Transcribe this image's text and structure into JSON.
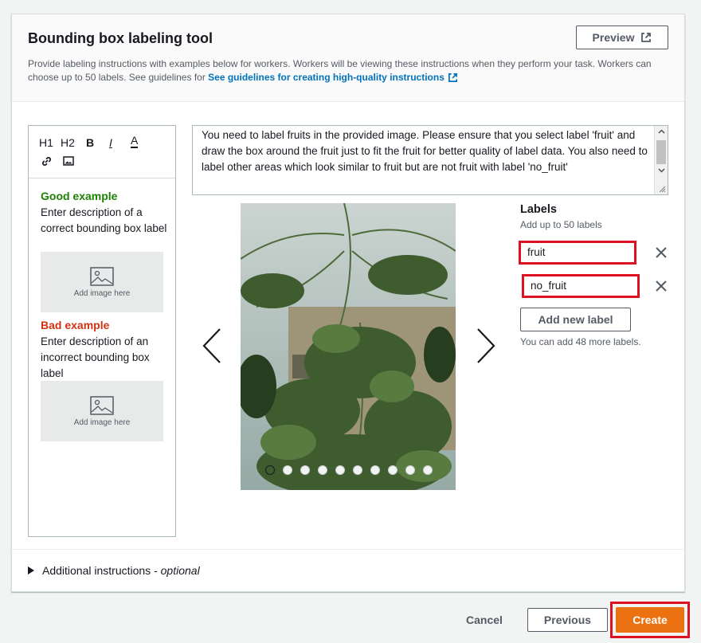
{
  "header": {
    "title": "Bounding box labeling tool",
    "description": "Provide labeling instructions with examples below for workers. Workers will be viewing these instructions when they perform your task. Workers can choose up to 50 labels. See guidelines for ",
    "guidelines_link": "See guidelines for creating high-quality instructions",
    "preview_label": "Preview"
  },
  "editor": {
    "toolbar": {
      "h1": "H1",
      "h2": "H2",
      "bold": "B",
      "italic": "I",
      "color": "A"
    },
    "good_example": {
      "heading": "Good example",
      "text": "Enter description of a correct bounding box label",
      "image_label": "Add image here"
    },
    "bad_example": {
      "heading": "Bad example",
      "text": "Enter description of an incorrect bounding box label",
      "image_label": "Add image here"
    }
  },
  "instructions": {
    "text": "You need to label fruits in the provided image. Please ensure that you select label 'fruit' and draw the box around the fruit just to fit the fruit for better quality of label data. You also need to label other areas which look similar to fruit but are not fruit with label 'no_fruit'"
  },
  "carousel": {
    "slide_count": 10,
    "active_index": 0
  },
  "labels": {
    "title": "Labels",
    "subtitle": "Add up to 50 labels",
    "items": [
      "fruit",
      "no_fruit"
    ],
    "add_button": "Add new label",
    "hint": "You can add 48 more labels."
  },
  "additional": {
    "label": "Additional instructions - ",
    "optional": "optional"
  },
  "actions": {
    "cancel": "Cancel",
    "previous": "Previous",
    "create": "Create"
  },
  "colors": {
    "good": "#1d8102",
    "bad": "#d13212",
    "primary": "#ec7211",
    "link": "#0073bb",
    "highlight": "#dd1122"
  }
}
